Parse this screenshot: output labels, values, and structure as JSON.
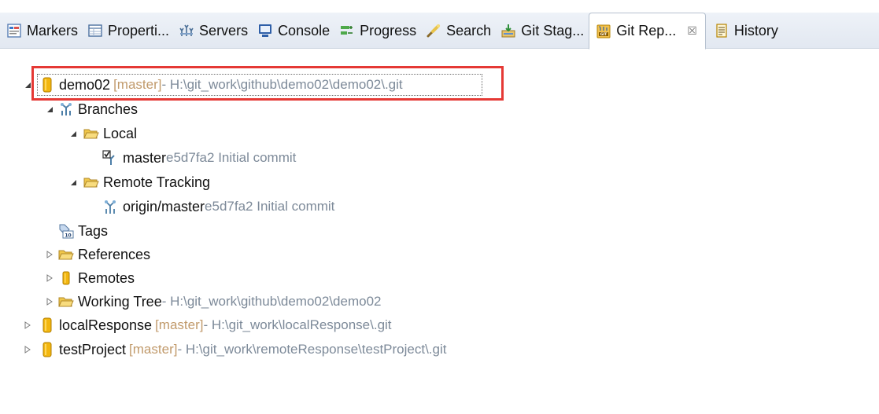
{
  "tabs": [
    {
      "label": "Markers",
      "icon": "markers-icon"
    },
    {
      "label": "Properti...",
      "icon": "properties-icon"
    },
    {
      "label": "Servers",
      "icon": "servers-icon"
    },
    {
      "label": "Console",
      "icon": "console-icon"
    },
    {
      "label": "Progress",
      "icon": "progress-icon"
    },
    {
      "label": "Search",
      "icon": "search-icon"
    },
    {
      "label": "Git Stag...",
      "icon": "git-staging-icon"
    },
    {
      "label": "Git Rep...",
      "icon": "git-repositories-icon",
      "active": true,
      "close": "☒"
    },
    {
      "label": "History",
      "icon": "history-icon"
    }
  ],
  "tree": {
    "demo02": {
      "name": "demo02",
      "branch": "[master]",
      "path": " - H:\\git_work\\github\\demo02\\demo02\\.git"
    },
    "branches": "Branches",
    "local": "Local",
    "master": {
      "name": "master",
      "info": " e5d7fa2 Initial commit"
    },
    "remote_tracking": "Remote Tracking",
    "origin_master": {
      "name": "origin/master",
      "info": " e5d7fa2 Initial commit"
    },
    "tags": "Tags",
    "references": "References",
    "remotes": "Remotes",
    "working_tree": {
      "name": "Working Tree",
      "path": " - H:\\git_work\\github\\demo02\\demo02"
    },
    "localResponse": {
      "name": "localResponse",
      "branch": "[master]",
      "path": " - H:\\git_work\\localResponse\\.git"
    },
    "testProject": {
      "name": "testProject",
      "branch": "[master]",
      "path": " - H:\\git_work\\remoteResponse\\testProject\\.git"
    }
  },
  "colors": {
    "highlight_border": "#e53935",
    "branch_tag": "#c19a6b",
    "decoration_text": "#7d8a99",
    "repo_icon": "#f2b60f"
  }
}
